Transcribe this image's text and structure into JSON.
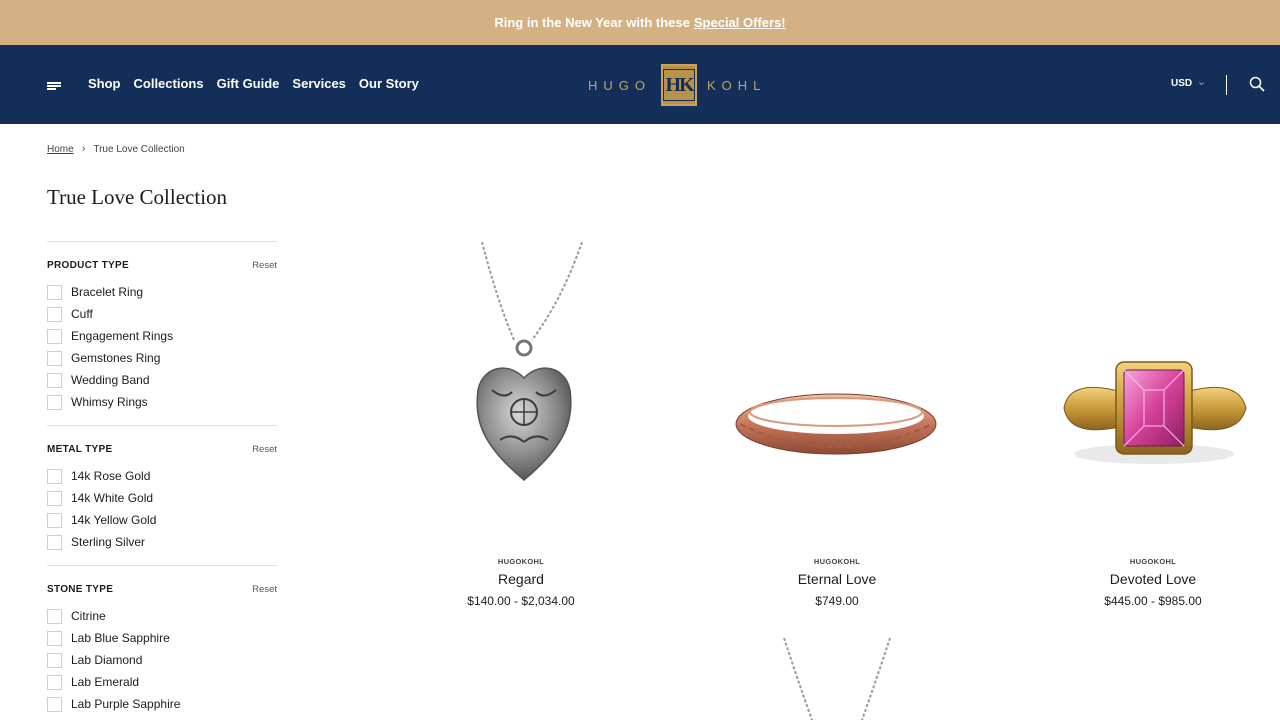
{
  "announcement": {
    "text": "Ring in the New Year with these",
    "link": "Special Offers!"
  },
  "nav": {
    "items": [
      "Shop",
      "Collections",
      "Gift Guide",
      "Services",
      "Our Story"
    ]
  },
  "logo": {
    "left": "HUGO",
    "mark": "HK",
    "right": "KOHL"
  },
  "currency": "USD",
  "breadcrumb": {
    "home": "Home",
    "current": "True Love Collection"
  },
  "page_title": "True Love Collection",
  "filters": [
    {
      "title": "PRODUCT TYPE",
      "reset": "Reset",
      "options": [
        "Bracelet Ring",
        "Cuff",
        "Engagement Rings",
        "Gemstones Ring",
        "Wedding Band",
        "Whimsy Rings"
      ]
    },
    {
      "title": "METAL TYPE",
      "reset": "Reset",
      "options": [
        "14k Rose Gold",
        "14k White Gold",
        "14k Yellow Gold",
        "Sterling Silver"
      ]
    },
    {
      "title": "STONE TYPE",
      "reset": "Reset",
      "options": [
        "Citrine",
        "Lab Blue Sapphire",
        "Lab Diamond",
        "Lab Emerald",
        "Lab Purple Sapphire"
      ]
    }
  ],
  "products": [
    {
      "brand": "HUGOKOHL",
      "name": "Regard",
      "price": "$140.00 - $2,034.00",
      "image": "silver-heart-pendant"
    },
    {
      "brand": "HUGOKOHL",
      "name": "Eternal Love",
      "price": "$749.00",
      "image": "rose-gold-band"
    },
    {
      "brand": "HUGOKOHL",
      "name": "Devoted Love",
      "price": "$445.00 - $985.00",
      "image": "pink-gem-ring"
    }
  ],
  "colors": {
    "announce_bg": "#d4b183",
    "header_bg": "#142e5a",
    "gold": "#c9a15a"
  }
}
